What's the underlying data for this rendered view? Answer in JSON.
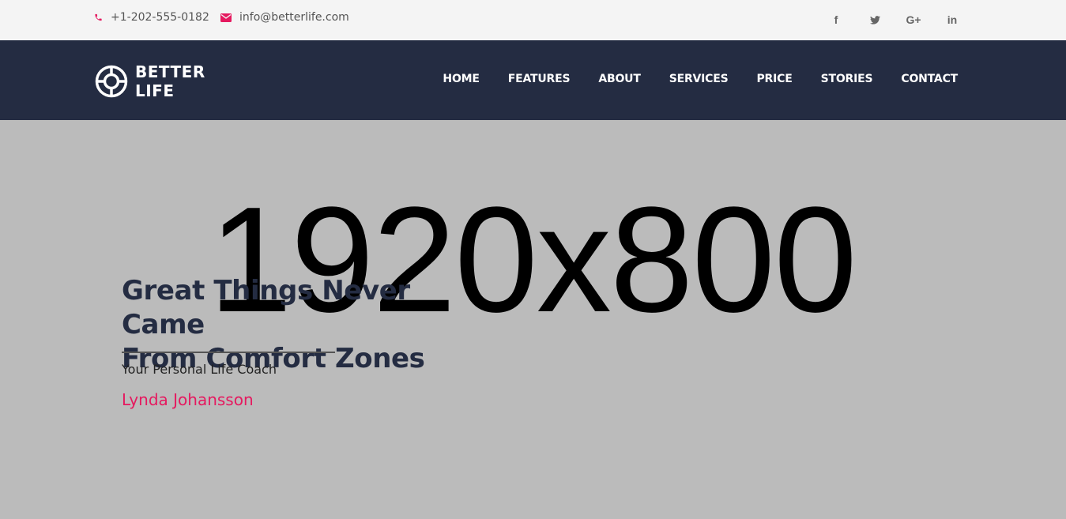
{
  "topbar": {
    "phone": "+1-202-555-0182",
    "email": "info@betterlife.com",
    "social": [
      {
        "icon": "facebook-icon",
        "glyph": "f"
      },
      {
        "icon": "twitter-icon",
        "glyph": "t"
      },
      {
        "icon": "google-plus-icon",
        "glyph": "G+"
      },
      {
        "icon": "linkedin-icon",
        "glyph": "in"
      }
    ]
  },
  "navbar": {
    "brand_line1": "BETTER",
    "brand_line2": "LIFE",
    "items": [
      "HOME",
      "FEATURES",
      "ABOUT",
      "SERVICES",
      "PRICE",
      "STORIES",
      "CONTACT"
    ]
  },
  "hero": {
    "placeholder": "1920x800",
    "headline_line1": "Great Things Never Came",
    "headline_line2": "From Comfort Zones",
    "tagline": "Your Personal Life Coach",
    "author": "Lynda Johansson"
  },
  "colors": {
    "accent": "#e5195f",
    "navy": "#242c42",
    "topbar_bg": "#f4f4f4",
    "hero_bg": "#bbbbbb"
  }
}
